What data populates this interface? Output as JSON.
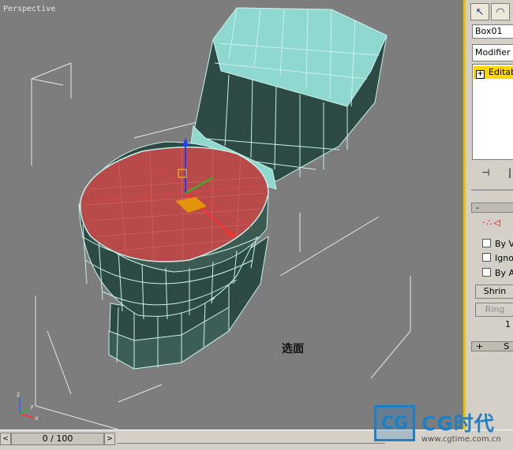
{
  "viewport": {
    "label": "Perspective",
    "annotation": "选面"
  },
  "axes": {
    "x": "x",
    "y": "y",
    "z": "z"
  },
  "timeline": {
    "frame_display": "0 / 100",
    "prev_glyph": "<",
    "next_glyph": ">"
  },
  "panel": {
    "tabs": [
      {
        "icon": "select-arrow-icon",
        "glyph": "↖"
      },
      {
        "icon": "curve-icon",
        "glyph": "◠"
      }
    ],
    "object_name": "Box01",
    "modifier_list": "Modifier Li",
    "stack_item": "Editab",
    "stack_expand": "+",
    "pin_glyph": "⊣",
    "rollout_minus": "-",
    "rollout_plus": "+",
    "rollout_plus_label": "S",
    "subobj_glyph": "·∴◁",
    "options": [
      {
        "label": "By V",
        "checked": false
      },
      {
        "label": "Ignor",
        "checked": false
      },
      {
        "label": "By Ar",
        "checked": false
      }
    ],
    "shrink_label": "Shrin",
    "ring_label": "Ring",
    "spinner_value": "1"
  },
  "watermark": {
    "mark": "CG",
    "brand": "CG时代",
    "url": "www.cgtime.com.cn"
  },
  "colors": {
    "viewport_bg": "#7d7d7d",
    "mesh_face": "#2e4a44",
    "mesh_top": "#8fd8cf",
    "mesh_edge": "#c8f0ea",
    "selected_face": "#b84a4a",
    "active_border": "#e8c400",
    "brand_blue": "#1e7fc4"
  }
}
